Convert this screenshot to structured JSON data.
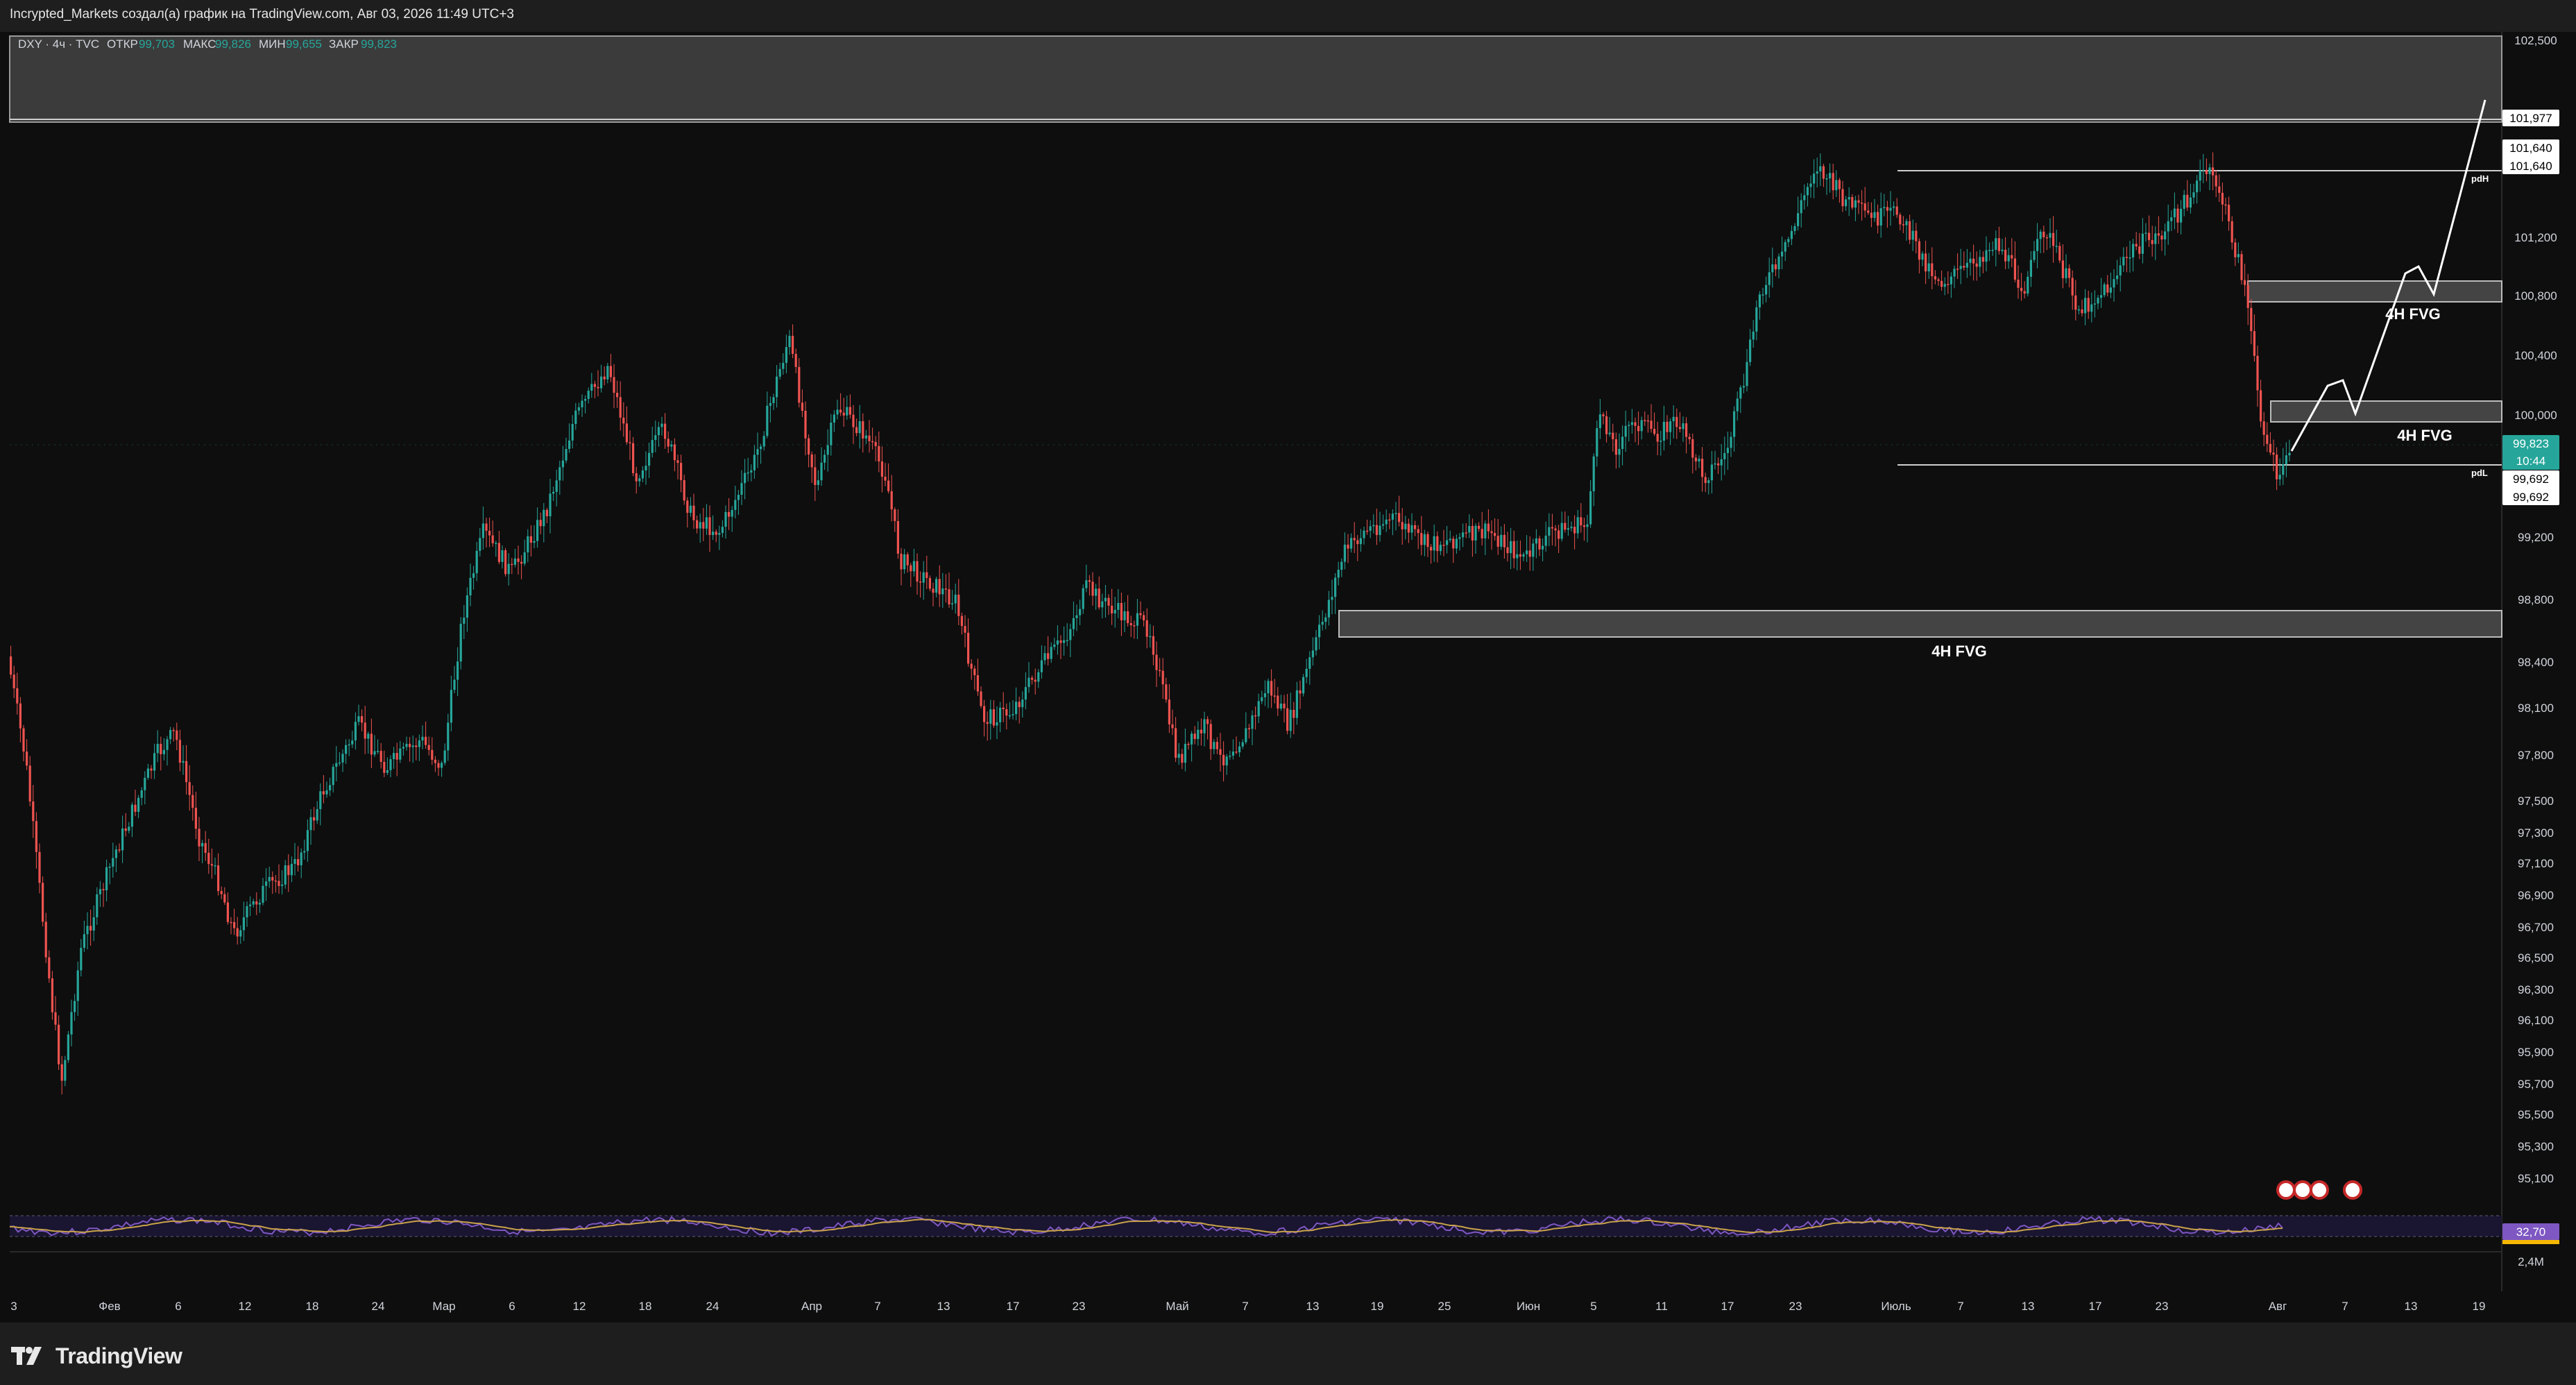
{
  "header": {
    "attribution": "Incrypted_Markets создал(а) график на TradingView.com, Авг 03, 2026 11:49 UTC+3"
  },
  "legend": {
    "symbol": "DXY · 4ч · TVC",
    "open_label": "ОТКР",
    "open_value": "99,703",
    "high_label": "МАКС",
    "high_value": "99,826",
    "low_label": "МИН",
    "low_value": "99,655",
    "close_label": "ЗАКР",
    "close_value": "99,823"
  },
  "colors": {
    "background": "#0e0e0e",
    "up": "#26a69a",
    "down": "#ef5350",
    "zone": "#555555",
    "current_price": "#26a69a",
    "rsi_line": "#7e57c2",
    "rsi_ma": "#ffb74d"
  },
  "price_axis": {
    "labels": [
      "102,500",
      "101,200",
      "100,800",
      "100,400",
      "100,000",
      "99,200",
      "98,800",
      "98,400",
      "98,100",
      "97,800",
      "97,500",
      "97,300",
      "97,100",
      "96,900",
      "96,700",
      "96,500",
      "96,300",
      "96,100",
      "95,900",
      "95,700",
      "95,500",
      "95,300",
      "95,100"
    ],
    "tags": {
      "level_a": "101,977",
      "pdh_1": "101,640",
      "pdh_2": "101,640",
      "current_price": "99,823",
      "countdown": "10:44",
      "pdl_1": "99,692",
      "pdl_2": "99,692",
      "rsi_value": "32,70",
      "volume_value": "2,4M"
    }
  },
  "time_axis": {
    "labels": [
      "3",
      "Фев",
      "6",
      "12",
      "18",
      "24",
      "Мар",
      "6",
      "12",
      "18",
      "24",
      "Апр",
      "7",
      "13",
      "17",
      "23",
      "Май",
      "7",
      "13",
      "19",
      "25",
      "Июн",
      "5",
      "11",
      "17",
      "23",
      "Июль",
      "7",
      "13",
      "17",
      "23",
      "Авг",
      "7",
      "13",
      "19"
    ]
  },
  "annotations": {
    "fvg_upper": "4H FVG",
    "fvg_middle": "4H FVG",
    "fvg_lower": "4H FVG",
    "pdh": "pdH",
    "pdl": "pdL"
  },
  "brand": {
    "name": "TradingView"
  }
}
